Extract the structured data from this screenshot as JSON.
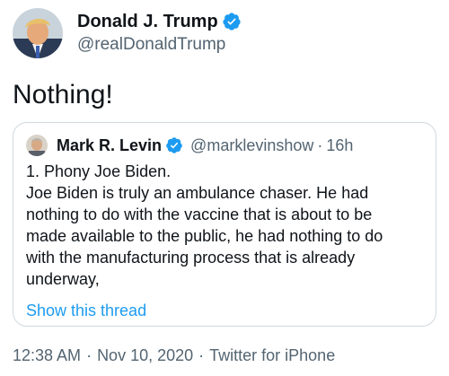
{
  "tweet": {
    "author": {
      "display_name": "Donald J. Trump",
      "handle": "@realDonaldTrump",
      "verified_icon": "verified-badge-icon",
      "avatar_icon": "avatar"
    },
    "text": "Nothing!",
    "quoted_tweet": {
      "author": {
        "display_name": "Mark R. Levin",
        "handle": "@marklevinshow",
        "verified_icon": "verified-badge-icon"
      },
      "separator": "·",
      "time": "16h",
      "body_lines": [
        "1. Phony Joe Biden.",
        "Joe Biden is truly an ambulance chaser.  He had",
        "nothing to do with the vaccine that is about to be",
        "made available to the public, he had nothing to do",
        "with the manufacturing process that is already",
        "underway,"
      ],
      "show_thread": "Show this thread"
    },
    "meta": {
      "time": "12:38 AM",
      "sep1": "·",
      "date": "Nov 10, 2020",
      "sep2": "·",
      "source": "Twitter for iPhone"
    }
  },
  "colors": {
    "text": "#0f1419",
    "secondary": "#536471",
    "link": "#1d9bf0",
    "verified": "#1d9bf0",
    "border": "#cfd9de"
  }
}
